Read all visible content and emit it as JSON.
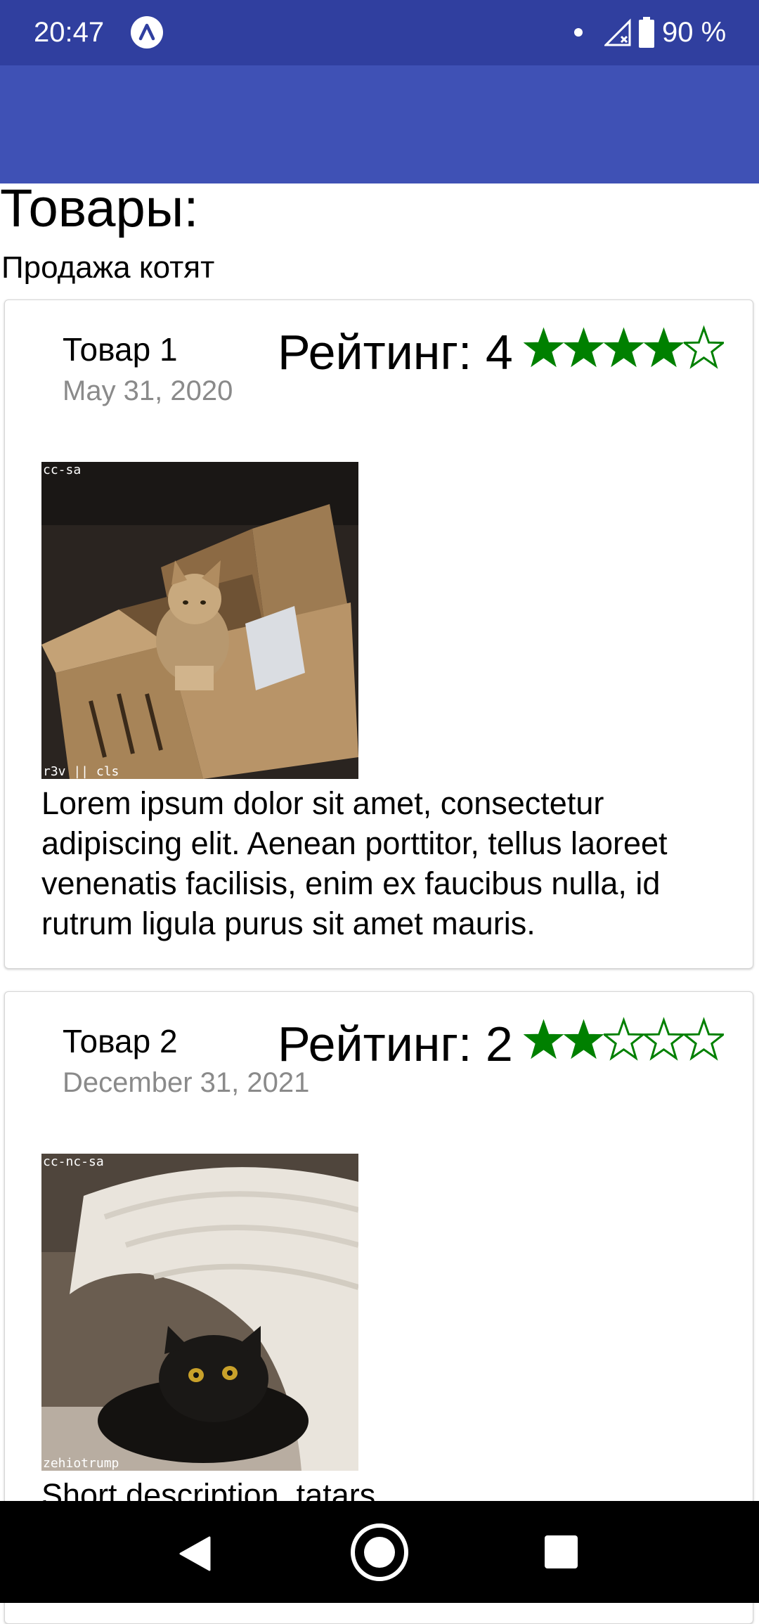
{
  "status_bar": {
    "time": "20:47",
    "battery_text": "90 %",
    "app_icon": "expo-a-icon",
    "signal_icon": "signal-no-data-icon",
    "battery_icon": "battery-icon",
    "background": "#303F9F"
  },
  "action_bar": {
    "background": "#3F51B5"
  },
  "page": {
    "title": "Товары:",
    "subtitle": "Продажа котят"
  },
  "products": [
    {
      "name": "Товар 1",
      "date": "May 31, 2020",
      "rating_label": "Рейтинг: 4",
      "rating": 4,
      "max_rating": 5,
      "image_label_top": "cc-sa",
      "image_label_bottom": "r3v || cls",
      "image_subject": "kitten sitting in a cardboard box",
      "description": "Lorem ipsum dolor sit amet, consectetur adipiscing elit. Aenean porttitor, tellus laoreet venenatis facilisis, enim ex faucibus nulla, id rutrum ligula purus sit amet mauris."
    },
    {
      "name": "Товар 2",
      "date": "December 31, 2021",
      "rating_label": "Рейтинг: 2",
      "rating": 2,
      "max_rating": 5,
      "image_label_top": "cc-nc-sa",
      "image_label_bottom": "zehiotrump",
      "image_subject": "black kitten hiding under a blanket",
      "description": "Short description, tatars"
    }
  ],
  "colors": {
    "star": "#008000",
    "date_text": "#8a8a8a"
  },
  "nav_bar": {
    "back_icon": "back-triangle-icon",
    "home_icon": "home-circle-icon",
    "recents_icon": "recents-square-icon"
  }
}
